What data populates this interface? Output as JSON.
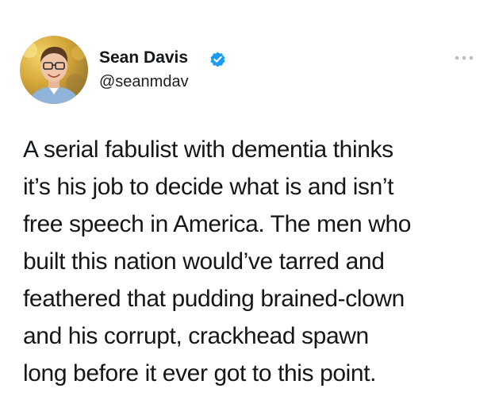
{
  "author": {
    "name": "Sean Davis",
    "handle": "@seanmdav",
    "verified": true,
    "avatar_icon": "profile-photo-icon"
  },
  "header": {
    "more_icon": "more-options-icon"
  },
  "tweet": {
    "lines": [
      "A serial fabulist with dementia thinks",
      "it’s his job to decide what is and isn’t",
      "free speech in America. The men who",
      "built this nation would’ve tarred and",
      "feathered that pudding brained-clown",
      "and his corrupt, crackhead spawn",
      "long before it ever got to this point."
    ]
  },
  "colors": {
    "verified_badge": "#1d9bf0",
    "text": "#14171a",
    "more_icon": "#b8bcc2"
  }
}
